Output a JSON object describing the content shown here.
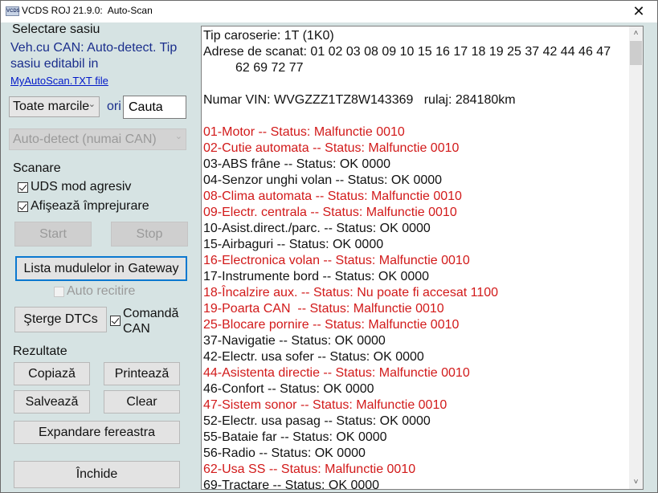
{
  "window": {
    "title": "VCDS ROJ 21.9.0:  Auto-Scan",
    "icon_text": "VCDS",
    "close_icon": "✕"
  },
  "left_panel": {
    "chassis_heading": "Selectare sasiu",
    "chassis_info_line1": "Veh.cu CAN: Auto-detect. Tip",
    "chassis_info_line2": "sasiu editabil in",
    "chassis_link": "MyAutoScan.TXT file",
    "make_combo": {
      "value": "Toate marcile",
      "arrow": "⌄"
    },
    "or_label": "ori",
    "search_input": {
      "value": "Cauta"
    },
    "type_combo": {
      "value": "Auto-detect (numai CAN)",
      "arrow": "⌄",
      "disabled": true
    },
    "scan_heading": "Scanare",
    "uds_checkbox": {
      "label": "UDS mod agresiv",
      "checked": true
    },
    "show_surroundings_checkbox": {
      "label": "Afişează împrejurare",
      "checked": true
    },
    "start_button": "Start",
    "stop_button": "Stop",
    "gateway_button": "Lista mudulelor in Gateway",
    "auto_reread_checkbox": {
      "label": "Auto recitire",
      "checked": false,
      "disabled": true
    },
    "clear_dtcs_button": "Şterge DTCs",
    "can_command_checkbox": {
      "label_line1": "Comandă",
      "label_line2": "CAN",
      "checked": true
    },
    "results_heading": "Rezultate",
    "copy_button": "Copiază",
    "print_button": "Printează",
    "save_button": "Salvează",
    "clear_button": "Clear",
    "expand_button": "Expandare fereastra",
    "close_button": "Închide"
  },
  "output": {
    "lines": [
      {
        "text": "Tip caroserie: 1T (1K0)",
        "status": "info"
      },
      {
        "text": "Adrese de scanat: 01 02 03 08 09 10 15 16 17 18 19 25 37 42 44 46 47",
        "status": "info"
      },
      {
        "text": "         62 69 72 77",
        "status": "info"
      },
      {
        "text": "",
        "status": "info"
      },
      {
        "text": "Numar VIN: WVGZZZ1TZ8W143369   rulaj: 284180km",
        "status": "info"
      },
      {
        "text": "",
        "status": "info"
      },
      {
        "text": "01-Motor -- Status: Malfunctie 0010",
        "status": "fault"
      },
      {
        "text": "02-Cutie automata -- Status: Malfunctie 0010",
        "status": "fault"
      },
      {
        "text": "03-ABS frâne -- Status: OK 0000",
        "status": "ok"
      },
      {
        "text": "04-Senzor unghi volan -- Status: OK 0000",
        "status": "ok"
      },
      {
        "text": "08-Clima automata -- Status: Malfunctie 0010",
        "status": "fault"
      },
      {
        "text": "09-Electr. centrala -- Status: Malfunctie 0010",
        "status": "fault"
      },
      {
        "text": "10-Asist.direct./parc. -- Status: OK 0000",
        "status": "ok"
      },
      {
        "text": "15-Airbaguri -- Status: OK 0000",
        "status": "ok"
      },
      {
        "text": "16-Electronica volan -- Status: Malfunctie 0010",
        "status": "fault"
      },
      {
        "text": "17-Instrumente bord -- Status: OK 0000",
        "status": "ok"
      },
      {
        "text": "18-Încalzire aux. -- Status: Nu poate fi accesat 1100",
        "status": "fault"
      },
      {
        "text": "19-Poarta CAN  -- Status: Malfunctie 0010",
        "status": "fault"
      },
      {
        "text": "25-Blocare pornire -- Status: Malfunctie 0010",
        "status": "fault"
      },
      {
        "text": "37-Navigatie -- Status: OK 0000",
        "status": "ok"
      },
      {
        "text": "42-Electr. usa sofer -- Status: OK 0000",
        "status": "ok"
      },
      {
        "text": "44-Asistenta directie -- Status: Malfunctie 0010",
        "status": "fault"
      },
      {
        "text": "46-Confort -- Status: OK 0000",
        "status": "ok"
      },
      {
        "text": "47-Sistem sonor -- Status: Malfunctie 0010",
        "status": "fault"
      },
      {
        "text": "52-Electr. usa pasag -- Status: OK 0000",
        "status": "ok"
      },
      {
        "text": "55-Bataie far -- Status: OK 0000",
        "status": "ok"
      },
      {
        "text": "56-Radio -- Status: OK 0000",
        "status": "ok"
      },
      {
        "text": "62-Usa SS -- Status: Malfunctie 0010",
        "status": "fault"
      },
      {
        "text": "69-Tractare -- Status: OK 0000",
        "status": "ok"
      }
    ],
    "scroll_up_icon": "˄",
    "scroll_down_icon": "˅"
  },
  "colors": {
    "fault": "#d21a1a",
    "ok": "#111111",
    "panel_bg": "#d6e3e3",
    "focus": "#0a78d0"
  }
}
